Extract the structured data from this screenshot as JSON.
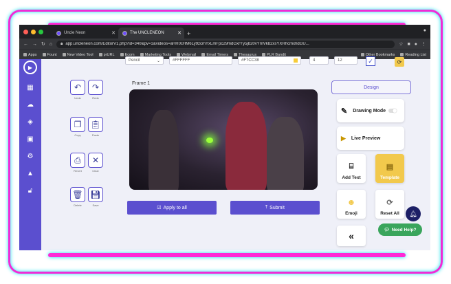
{
  "browser": {
    "tabs": [
      {
        "label": "Uncle Neon",
        "active": false
      },
      {
        "label": "The UNCLENEON",
        "active": true
      }
    ],
    "url": "app.uncleneon.com/EditorV1.php?id=340&pv=1&videos=aHR0cHM6Ly9zcmYxLmFpc29mdGxrYy5jb20vYmVkb2xsYXRhcmxhdGU...",
    "bookmarks": [
      "Apps",
      "Fount",
      "New Video Tool",
      "prURL",
      "Ecom",
      "Marketing Tools",
      "Webmail",
      "Email Timers",
      "Thesaurus",
      "PLR Bandit"
    ],
    "bookmarks_right": [
      "Other Bookmarks",
      "Reading List"
    ]
  },
  "toolbar_top": {
    "font_select": "Pencil",
    "color1": "#FFFFFF",
    "color2": "#F7CC38",
    "num1": "4",
    "num2": "12"
  },
  "editor": {
    "frame_label": "Frame 1",
    "tools": [
      {
        "label": "Undo",
        "icon": "undo-icon"
      },
      {
        "label": "Redo",
        "icon": "redo-icon"
      },
      {
        "label": "Copy",
        "icon": "copy-icon"
      },
      {
        "label": "Paste",
        "icon": "paste-icon"
      },
      {
        "label": "Revert",
        "icon": "revert-icon"
      },
      {
        "label": "Clear",
        "icon": "clear-icon"
      },
      {
        "label": "Delete",
        "icon": "delete-icon"
      },
      {
        "label": "Save",
        "icon": "save-icon"
      }
    ],
    "apply_label": "Apply to all",
    "submit_label": "Submit"
  },
  "panel": {
    "design_label": "Design",
    "drawing_mode": "Drawing Mode",
    "live_preview": "Live Preview",
    "add_text": "Add Text",
    "template": "Template",
    "emoji": "Emoji",
    "reset_all": "Reset All"
  },
  "help": {
    "label": "Need Help?"
  },
  "colors": {
    "accent": "#5b4fcf",
    "neon_pink": "#ff2bd6",
    "neon_cyan": "#19e3ef",
    "template_yellow": "#f2c94c",
    "help_green": "#3aa55c"
  }
}
